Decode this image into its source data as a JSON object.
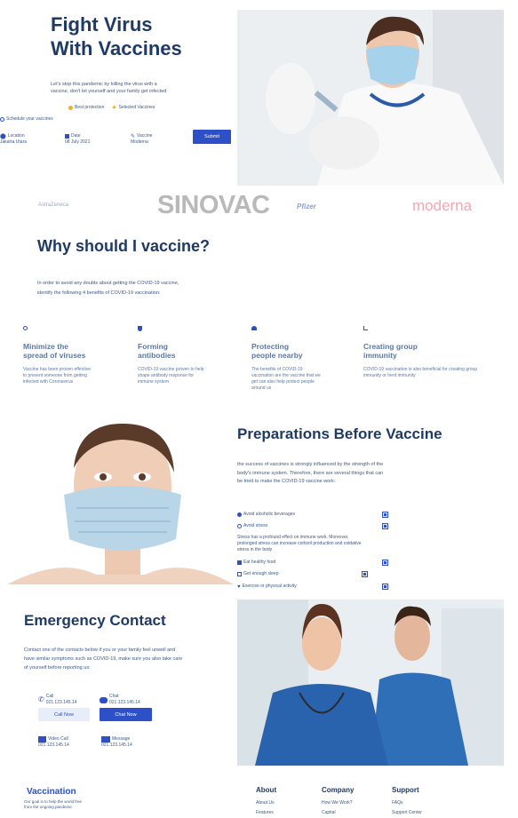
{
  "hero": {
    "title_line1": "Fight Virus",
    "title_line2": "With Vaccines",
    "subtitle": "Let's stop this pandemic by killing the virus with a vaccine, don't let yourself and your family get infected",
    "badge1": "Best protection",
    "badge2": "Selected Vaccines",
    "schedule_label": "Schedule your vaccines",
    "location_label": "Location",
    "location_value": "Jakarta Utara",
    "date_label": "Date",
    "date_value": "08 July 2021",
    "vaccine_label": "Vaccine",
    "vaccine_value": "Moderna",
    "submit_label": "Submit"
  },
  "brands": [
    "AstraZeneca",
    "SINOVAC",
    "Pfizer",
    "moderna"
  ],
  "why": {
    "title": "Why should I vaccine?",
    "intro": "In order to avoid any doubts about getting the COVID-19 vaccine, identify the following 4 benefits of COVID-19 vaccination:",
    "cards": [
      {
        "title_line1": "Minimize the",
        "title_line2": "spread of viruses",
        "text": "Vaccine has been proven effective to prevent someone from getting infected with Coronavirus"
      },
      {
        "title_line1": "Forming",
        "title_line2": "antibodies",
        "text": "COVID-19 vaccine proven to help shape antibody response for immune system"
      },
      {
        "title_line1": "Protecting",
        "title_line2": "people nearby",
        "text": "The benefits of COVID-19 vaccination are the vaccine that we get can also help protect people around us"
      },
      {
        "title_line1": "Creating group",
        "title_line2": "immunity",
        "text": "COVID-19 vaccination is also beneficial for creating group immunity or herd immunity"
      }
    ]
  },
  "prep": {
    "title": "Preparations Before Vaccine",
    "intro": "the success of vaccines is strongly influenced by the strength of the body's immune system. Therefore, there are several things that can be tried to make the COVID-19 vaccine work:",
    "items": [
      {
        "label": "Avoid alcoholic beverages"
      },
      {
        "label": "Avoid stress"
      },
      {
        "label": "Eat healthy food"
      },
      {
        "label": "Get enough sleep"
      },
      {
        "label": "Exercise or physical activity"
      }
    ],
    "stress_note": "Stress has a profound effect on immune work. Moreover, prolonged stress can increase cortisol production and oxidative stress in the body"
  },
  "emergency": {
    "title": "Emergency Contact",
    "intro": "Contact one of the contacts below if you or your family feel unwell and have similar symptoms such as COVID-19, make sure you also take care of yourself before reporting us:",
    "call_label": "Call",
    "call_number": "021.123.145.14",
    "call_button": "Call Now",
    "chat_label": "Chat",
    "chat_number": "021.123.145.14",
    "chat_button": "Chat Now",
    "video_label": "Video Call",
    "video_number": "021.123.145.14",
    "message_label": "Message",
    "message_number": "021.123.145.14"
  },
  "footer": {
    "brand": "Vaccination",
    "tagline": "Our goal is to help the world free from the ongoing pandemic",
    "col1_title": "About",
    "col1_links": [
      "About Us",
      "Features"
    ],
    "col2_title": "Company",
    "col2_links": [
      "How We Work?",
      "Capital"
    ],
    "col3_title": "Support",
    "col3_links": [
      "FAQs",
      "Support Center"
    ]
  },
  "colors": {
    "primary": "#2d4fc8",
    "heading": "#1f3a63",
    "muted": "#5c78a3"
  }
}
